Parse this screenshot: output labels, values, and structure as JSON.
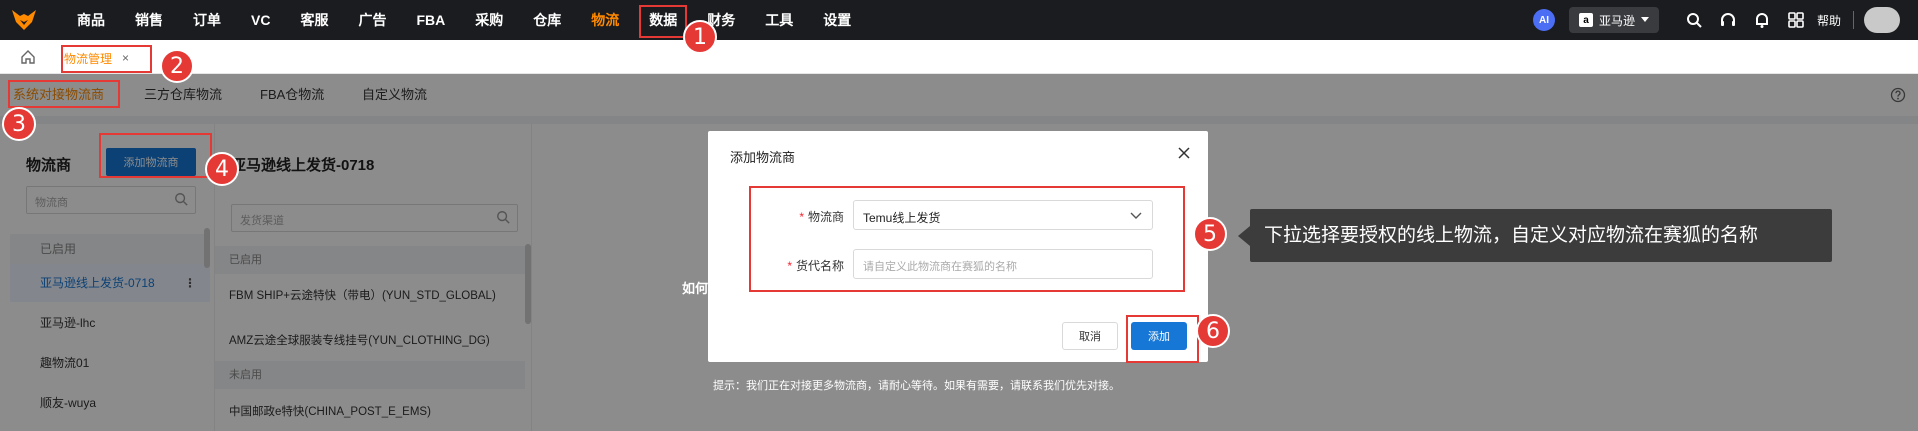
{
  "topnav": {
    "items": [
      "商品",
      "销售",
      "订单",
      "VC",
      "客服",
      "广告",
      "FBA",
      "采购",
      "仓库",
      "物流",
      "数据",
      "财务",
      "工具",
      "设置"
    ],
    "active": "物流",
    "ai_label": "AI",
    "store_logo": "a",
    "store_name": "亚马逊",
    "help": "帮助"
  },
  "tabstrip": {
    "page_tab": "物流管理",
    "close": "×"
  },
  "subtabs": [
    "系统对接物流商",
    "三方仓库物流",
    "FBA仓物流",
    "自定义物流"
  ],
  "left_panel": {
    "title": "物流商",
    "add_button": "添加物流商",
    "search_placeholder": "物流商",
    "group_enabled": "已启用",
    "items": [
      "亚马逊线上发货-0718",
      "亚马逊-lhc",
      "趣物流01",
      "顺友-wuya"
    ],
    "more": "⋮"
  },
  "mid_panel": {
    "title": "亚马逊线上发货-0718",
    "search_placeholder": "发货渠道",
    "group_enabled": "已启用",
    "enabled_items": [
      "FBM SHIP+云途特快（带电）(YUN_STD_GLOBAL)",
      "AMZ云途全球服装专线挂号(YUN_CLOTHING_DG)"
    ],
    "group_disabled": "未启用",
    "disabled_items": [
      "中国邮政e特快(CHINA_POST_E_EMS)"
    ]
  },
  "right_partial": "如何",
  "hint": "提示：我们正在对接更多物流商，请耐心等待。如果有需要，请联系我们优先对接。",
  "modal": {
    "title": "添加物流商",
    "close": "×",
    "label_carrier": "物流商",
    "carrier_value": "Temu线上发货",
    "label_name": "货代名称",
    "name_placeholder": "请自定义此物流商在赛狐的名称",
    "required_mark": "*",
    "cancel": "取消",
    "confirm": "添加"
  },
  "annotations": {
    "numbers": [
      "1",
      "2",
      "3",
      "4",
      "5",
      "6"
    ],
    "callout": "下拉选择要授权的线上物流，自定义对应物流在赛狐的名称"
  },
  "colors": {
    "accent": "#ff8a00",
    "primary": "#1677d6",
    "annotation": "#e53935",
    "nav_bg": "#1b1c1f"
  }
}
